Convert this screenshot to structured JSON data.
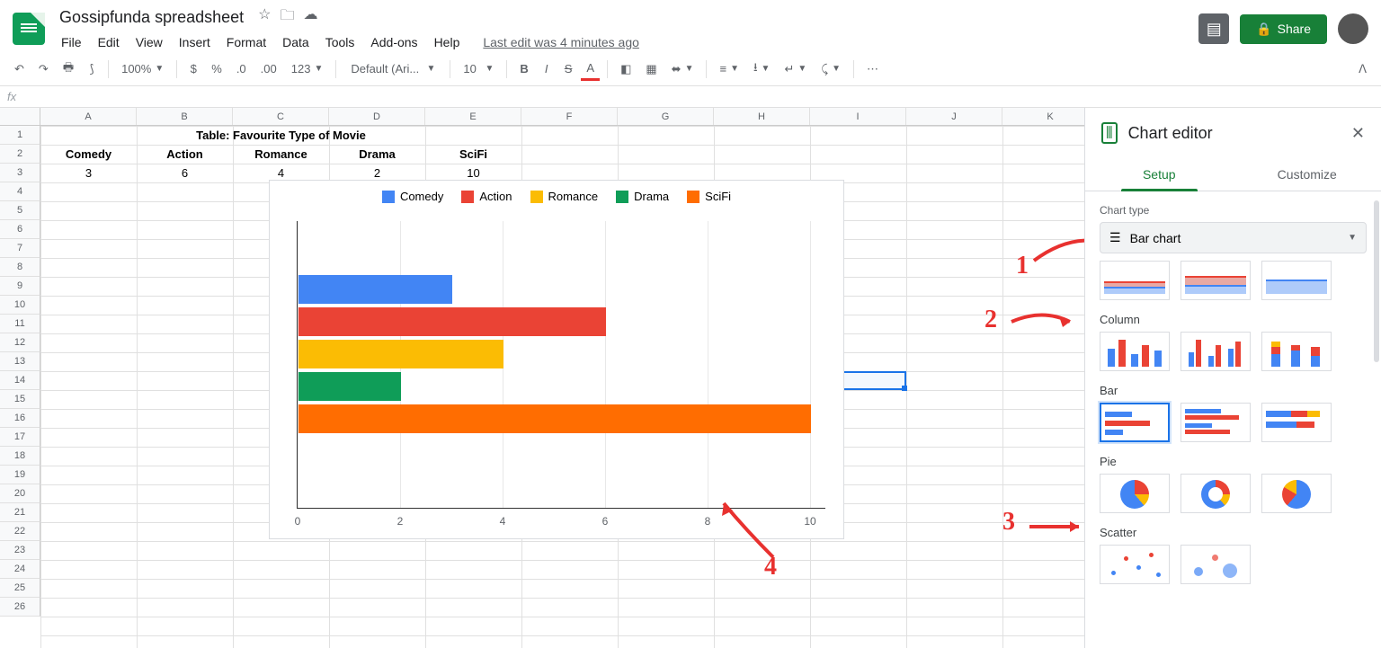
{
  "doc_title": "Gossipfunda spreadsheet",
  "menus": [
    "File",
    "Edit",
    "View",
    "Insert",
    "Format",
    "Data",
    "Tools",
    "Add-ons",
    "Help"
  ],
  "last_edit": "Last edit was 4 minutes ago",
  "share_label": "Share",
  "toolbar": {
    "zoom": "100%",
    "font": "Default (Ari...",
    "font_size": "10",
    "more_formats": "123"
  },
  "columns": [
    "A",
    "B",
    "C",
    "D",
    "E",
    "F",
    "G",
    "H",
    "I",
    "J",
    "K"
  ],
  "rows": 26,
  "table_title": "Table: Favourite Type of Movie",
  "headers": [
    "Comedy",
    "Action",
    "Romance",
    "Drama",
    "SciFi"
  ],
  "values": [
    "3",
    "6",
    "4",
    "2",
    "10"
  ],
  "chart_editor": {
    "title": "Chart editor",
    "tabs": {
      "setup": "Setup",
      "customize": "Customize"
    },
    "chart_type_label": "Chart type",
    "chart_type_value": "Bar chart",
    "sections": {
      "column": "Column",
      "bar": "Bar",
      "pie": "Pie",
      "scatter": "Scatter"
    }
  },
  "chart_data": {
    "type": "bar",
    "orientation": "horizontal",
    "categories": [
      "Comedy",
      "Action",
      "Romance",
      "Drama",
      "SciFi"
    ],
    "values": [
      3,
      6,
      4,
      2,
      10
    ],
    "colors": [
      "#4285f4",
      "#ea4335",
      "#fbbc04",
      "#0f9d58",
      "#ff6d01"
    ],
    "xlim": [
      0,
      10
    ],
    "xticks": [
      0,
      2,
      4,
      6,
      8,
      10
    ],
    "legend_position": "top",
    "title": "",
    "xlabel": "",
    "ylabel": ""
  },
  "annotations": {
    "a1": "1",
    "a2": "2",
    "a3": "3",
    "a4": "4"
  }
}
